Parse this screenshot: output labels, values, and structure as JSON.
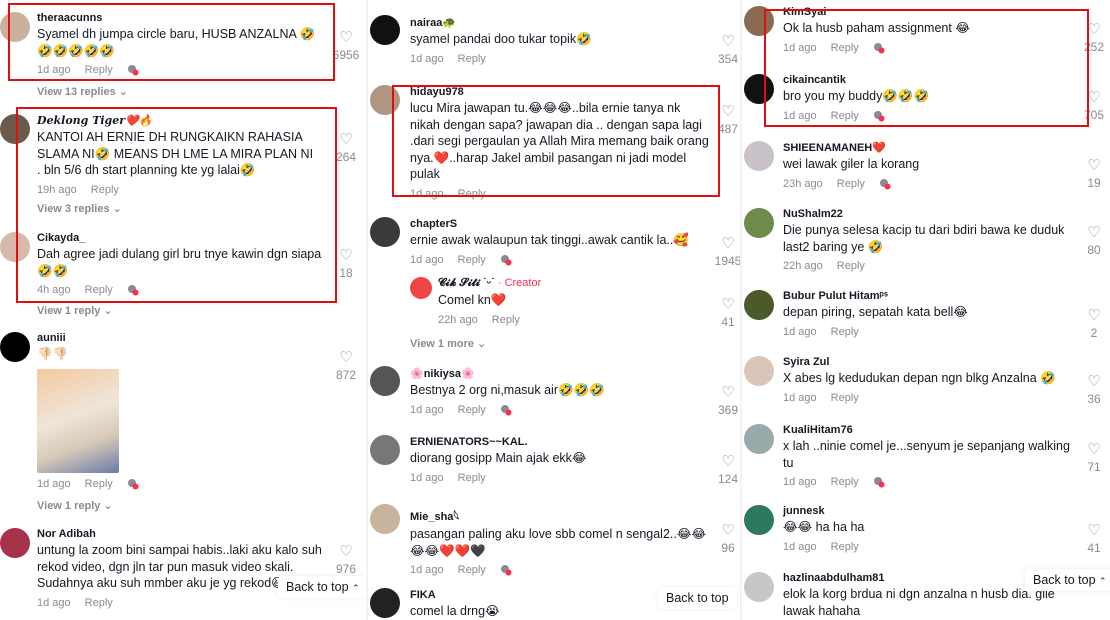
{
  "ui": {
    "reply_label": "Reply",
    "back_to_top": "Back to top"
  },
  "col1": {
    "c1": {
      "user": "theraacunns",
      "text": "Syamel dh jumpa circle baru, HUSB ANZALNA 🤣🤣🤣🤣🤣🤣",
      "time": "1d ago",
      "likes": "6956"
    },
    "c1_replies": "View 13 replies ⌄",
    "c2": {
      "user": "Deklong Tiger❤️🔥",
      "text": "KANTOI AH ERNIE DH RUNGKAIKN RAHASIA SLAMA NI🤣 MEANS DH LME LA MIRA PLAN NI . bln 5/6 dh start planning kte yg lalai🤣",
      "time": "19h ago",
      "likes": "264"
    },
    "c2_replies": "View 3 replies ⌄",
    "c3": {
      "user": "Cikayda_",
      "text": "Dah agree jadi dulang girl bru tnye kawin dgn siapa 🤣🤣",
      "time": "4h ago",
      "likes": "18"
    },
    "c3_replies": "View 1 reply ⌄",
    "c4": {
      "user": "auniii",
      "text": "👎🏻👎🏻",
      "time": "1d ago",
      "likes": "872"
    },
    "c4_replies": "View 1 reply ⌄",
    "c5": {
      "user": "Nor Adibah",
      "text": "untung la zoom bini sampai habis..laki aku kalo suh rekod video, dgn jln tar pun masuk video skali. Sudahnya aku suh mmber aku je yg rekod😆",
      "time": "1d ago",
      "likes": "976"
    }
  },
  "col2": {
    "c1": {
      "user": "nairaa🐢",
      "text": "syamel pandai doo tukar topik🤣",
      "time": "1d ago",
      "likes": "354"
    },
    "c2": {
      "user": "hidayu978",
      "text": "lucu Mira jawapan tu.😂😂😂..bila ernie tanya nk nikah dengan sapa? jawapan dia .. dengan sapa lagi .dari segi pergaulan ya Allah Mira memang baik orang nya.❤️..harap Jakel ambil pasangan ni jadi model pulak",
      "time": "1d ago",
      "likes": "487"
    },
    "c3": {
      "user": "chapterS",
      "text": "ernie awak walaupun tak tinggi..awak cantik la..🥰",
      "time": "1d ago",
      "likes": "1945"
    },
    "c3r": {
      "user": "𝓒𝓲𝓴 𝓢𝓲𝓽𝓲 ˙ᵕ˙",
      "badge": "· Creator",
      "text": "Comel kn❤️",
      "time": "22h ago",
      "likes": "41"
    },
    "c3_more": "View 1 more ⌄",
    "c4": {
      "user": "🌸nikiysa🌸",
      "text": "Bestnya 2 org ni,masuk air🤣🤣🤣",
      "time": "1d ago",
      "likes": "369"
    },
    "c5": {
      "user": "ERNIENATORS~~KAL.",
      "text": "diorang gosipp Main ajak ekk😂",
      "time": "1d ago",
      "likes": "124"
    },
    "c6": {
      "user": "Mie_sha𓆩",
      "text": "pasangan paling aku love sbb comel n sengal2..😂😂😂😂❤️❤️🖤",
      "time": "1d ago",
      "likes": "96"
    },
    "c7": {
      "user": "FIKA",
      "text": "comel la drng😭"
    }
  },
  "col3": {
    "c1": {
      "user": "KimSyai",
      "text": "Ok la husb paham assignment 😂",
      "time": "1d ago",
      "likes": "252"
    },
    "c2": {
      "user": "cikaincantik",
      "text": "bro you my buddy🤣🤣🤣",
      "time": "1d ago",
      "likes": "705"
    },
    "c3": {
      "user": "SHIEENAMANEH❤️",
      "text": "wei lawak giler la korang",
      "time": "23h ago",
      "likes": "19"
    },
    "c4": {
      "user": "NuShalm22",
      "text": "Die punya selesa kacip tu dari bdiri bawa ke duduk last2 baring ye 🤣",
      "time": "22h ago",
      "likes": "80"
    },
    "c5": {
      "user": "Bubur Pulut Hitamᵖˢ",
      "text": "depan piring, sepatah kata bell😂",
      "time": "1d ago",
      "likes": "2"
    },
    "c6": {
      "user": "Syira Zul",
      "text": "X abes lg kedudukan depan ngn blkg Anzalna 🤣",
      "time": "1d ago",
      "likes": "36"
    },
    "c7": {
      "user": "KualiHitam76",
      "text": "x lah ..ninie comel je...senyum je sepanjang walking tu",
      "time": "1d ago",
      "likes": "71"
    },
    "c8": {
      "user": "junnesk",
      "text": "😂😂 ha ha ha",
      "time": "1d ago",
      "likes": "41"
    },
    "c9": {
      "user": "hazlinaabdulham81",
      "text": "elok la korg brdua ni dgn anzalna n husb dia. gile lawak hahaha"
    }
  }
}
